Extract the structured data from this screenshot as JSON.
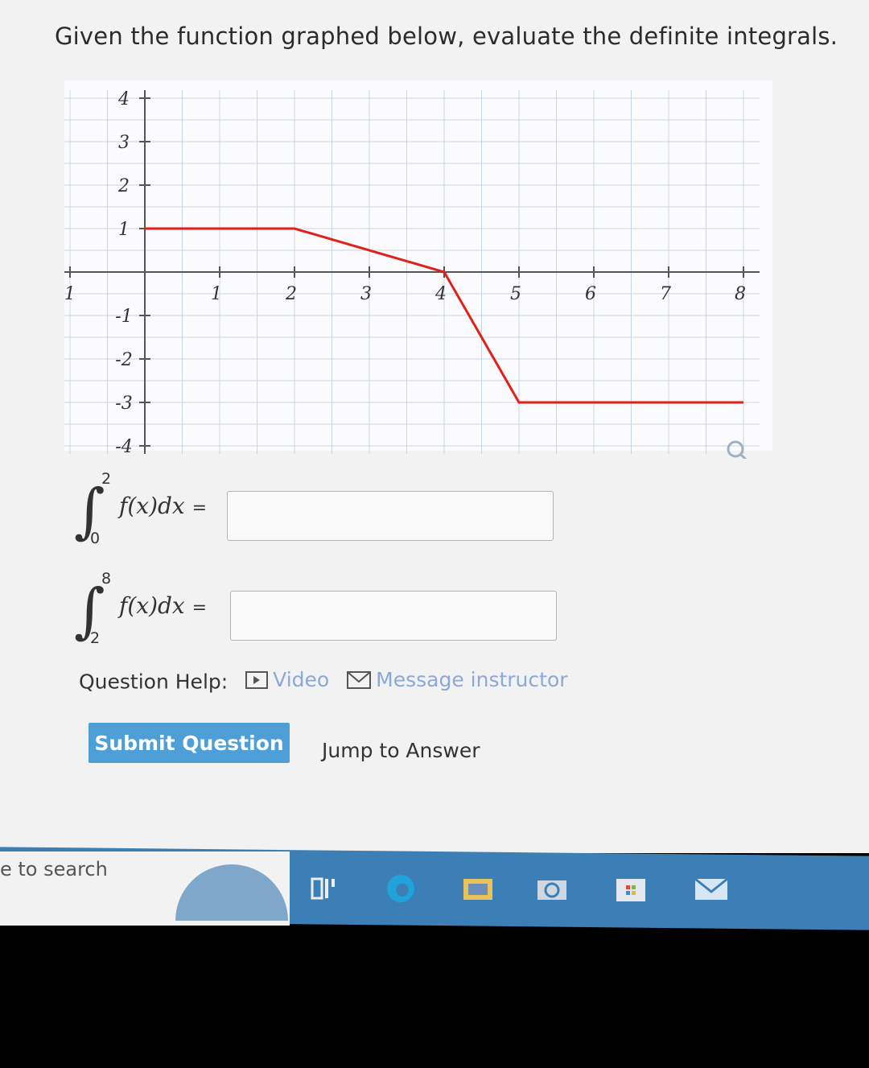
{
  "question": {
    "title": "Given the function graphed below, evaluate the definite integrals."
  },
  "graph": {
    "x_ticks": [
      "-1",
      "1",
      "2",
      "3",
      "4",
      "5",
      "6",
      "7",
      "8"
    ],
    "y_ticks": [
      "4",
      "3",
      "2",
      "1",
      "-1",
      "-2",
      "-3",
      "-4"
    ],
    "line_color": "#e0201a",
    "grid_color": "#c9d4e3"
  },
  "chart_data": {
    "type": "line",
    "x": [
      0,
      2,
      4,
      5,
      8
    ],
    "y": [
      1,
      1,
      0,
      -3,
      -3
    ],
    "xlim": [
      -1,
      8
    ],
    "ylim": [
      -4,
      4
    ],
    "grid": true
  },
  "integrals": [
    {
      "lower": "0",
      "upper": "2",
      "integrand": "f(x)dx",
      "equals": "=",
      "value": ""
    },
    {
      "lower": "2",
      "upper": "8",
      "integrand": "f(x)dx",
      "equals": "=",
      "value": ""
    }
  ],
  "help": {
    "label": "Question Help:",
    "video_label": "Video",
    "message_label": "Message instructor",
    "video_icon": "video-icon",
    "message_icon": "envelope-icon"
  },
  "actions": {
    "submit_label": "Submit Question",
    "jump_label": "Jump to Answer"
  },
  "taskbar": {
    "search_text": "e to search",
    "icons": [
      "task-view-icon",
      "edge-icon",
      "folder-icon",
      "camera-icon",
      "store-icon",
      "mail-icon"
    ],
    "accent": "#3c7fb6"
  }
}
